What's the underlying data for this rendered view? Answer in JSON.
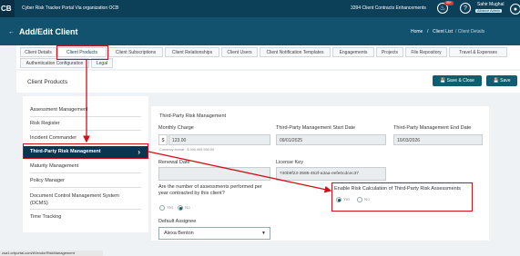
{
  "header": {
    "logo": "CB",
    "app_title": "Cyber Risk Tracker Portal Via organization OCB",
    "enhancements": "3394 Client Contracts Enhancements",
    "notif_count": "99+",
    "user_name": "Sahir Mughal",
    "user_role": "Alliance Admin"
  },
  "page": {
    "title": "Add/Edit Client",
    "breadcrumb": [
      "Home",
      "/",
      "Client List",
      "/ Client Details"
    ]
  },
  "tabs": [
    "Client Details",
    "Client Products",
    "Client Subscriptions",
    "Client Relationships",
    "Client Users",
    "Client Notification Templates",
    "Engagements",
    "Projects",
    "File Repository",
    "Travel & Expenses",
    "Authentication Configuration",
    "Legal"
  ],
  "section": {
    "title": "Client Products",
    "save_close": "Save & Close",
    "save": "Save"
  },
  "sidebar": {
    "items": [
      "Assessment Management",
      "Risk Register",
      "Incident Commander",
      "Third-Party Risk Management",
      "Maturity Management",
      "Policy Manager",
      "Document Control Management System (DCMS)",
      "Time Tracking"
    ]
  },
  "form": {
    "title": "Third-Party Risk Management",
    "monthly_charge_label": "Monthly Charge",
    "currency_symbol": "$",
    "monthly_charge_value": "123.00",
    "currency_hint": "Currency format : $ 999,999,999.99",
    "start_date_label": "Third-Party Management Start Date",
    "start_date_value": "09/01/2025",
    "end_date_label": "Third-Party Management End Date",
    "end_date_value": "10/03/2026",
    "renewal_label": "Renewal Date",
    "renewal_value": "",
    "license_label": "License Key",
    "license_value": "740b9f23-3586-452f-a3aa-eefe0cdcec37",
    "assess_question": "Are the number of assessments performed per year contracted by this client?",
    "yes": "Yes",
    "no": "No",
    "enable_label": "Enable Risk Calculation of Third-Party Risk Assessments",
    "default_assignee_label": "Default Assignee",
    "default_assignee_value": "Alexa Benton"
  },
  "status_url": "csa1.crtportal.com/#VendorRiskManagement"
}
